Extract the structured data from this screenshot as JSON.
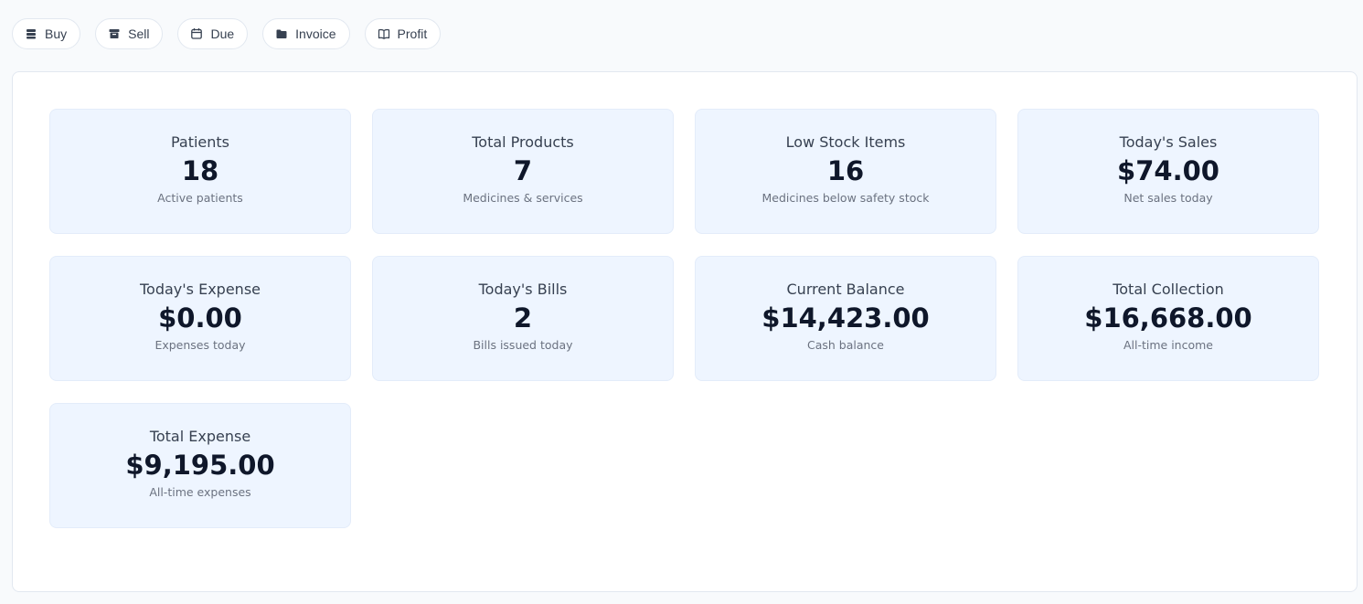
{
  "toolbar": {
    "buttons": [
      {
        "label": "Buy",
        "icon": "stack-icon"
      },
      {
        "label": "Sell",
        "icon": "archive-box-icon"
      },
      {
        "label": "Due",
        "icon": "calendar-icon"
      },
      {
        "label": "Invoice",
        "icon": "folder-icon"
      },
      {
        "label": "Profit",
        "icon": "book-icon"
      }
    ]
  },
  "stats": [
    {
      "label": "Patients",
      "value": "18",
      "sub": "Active patients"
    },
    {
      "label": "Total Products",
      "value": "7",
      "sub": "Medicines & services"
    },
    {
      "label": "Low Stock Items",
      "value": "16",
      "sub": "Medicines below safety stock"
    },
    {
      "label": "Today's Sales",
      "value": "$74.00",
      "sub": "Net sales today"
    },
    {
      "label": "Today's Expense",
      "value": "$0.00",
      "sub": "Expenses today"
    },
    {
      "label": "Today's Bills",
      "value": "2",
      "sub": "Bills issued today"
    },
    {
      "label": "Current Balance",
      "value": "$14,423.00",
      "sub": "Cash balance"
    },
    {
      "label": "Total Collection",
      "value": "$16,668.00",
      "sub": "All-time income"
    },
    {
      "label": "Total Expense",
      "value": "$9,195.00",
      "sub": "All-time expenses"
    }
  ],
  "colors": {
    "page_bg": "#f8fafc",
    "card_bg": "#eef5ff",
    "border": "#e2e8f0",
    "value_text": "#0f172a",
    "muted_text": "#6b7280"
  }
}
